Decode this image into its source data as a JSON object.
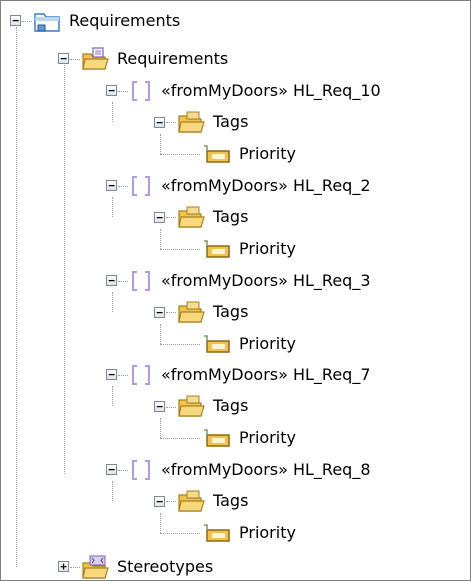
{
  "tree": {
    "root": {
      "label": "Requirements",
      "icon": "package-folder-icon",
      "expanded": true,
      "children": [
        {
          "label": "Requirements",
          "icon": "requirements-folder-icon",
          "expanded": true,
          "children": [
            {
              "label": "«fromMyDoors» HL_Req_10",
              "icon": "requirement-icon",
              "expanded": true,
              "tags": {
                "label": "Tags",
                "icon": "tags-folder-icon",
                "items": [
                  {
                    "label": "Priority",
                    "icon": "tag-icon"
                  }
                ]
              }
            },
            {
              "label": "«fromMyDoors» HL_Req_2",
              "icon": "requirement-icon",
              "expanded": true,
              "tags": {
                "label": "Tags",
                "icon": "tags-folder-icon",
                "items": [
                  {
                    "label": "Priority",
                    "icon": "tag-icon"
                  }
                ]
              }
            },
            {
              "label": "«fromMyDoors» HL_Req_3",
              "icon": "requirement-icon",
              "expanded": true,
              "tags": {
                "label": "Tags",
                "icon": "tags-folder-icon",
                "items": [
                  {
                    "label": "Priority",
                    "icon": "tag-icon"
                  }
                ]
              }
            },
            {
              "label": "«fromMyDoors» HL_Req_7",
              "icon": "requirement-icon",
              "expanded": true,
              "tags": {
                "label": "Tags",
                "icon": "tags-folder-icon",
                "items": [
                  {
                    "label": "Priority",
                    "icon": "tag-icon"
                  }
                ]
              }
            },
            {
              "label": "«fromMyDoors» HL_Req_8",
              "icon": "requirement-icon",
              "expanded": true,
              "tags": {
                "label": "Tags",
                "icon": "tags-folder-icon",
                "items": [
                  {
                    "label": "Priority",
                    "icon": "tag-icon"
                  }
                ]
              }
            }
          ]
        },
        {
          "label": "Stereotypes",
          "icon": "stereotypes-folder-icon",
          "expanded": false,
          "toggle_symbol": "+"
        }
      ]
    },
    "collapse_symbol": "−"
  },
  "colors": {
    "folder_yellow": "#f2c24f",
    "folder_blue": "#5f9ad6",
    "requirement_bracket": "#b79ad9",
    "tree_line": "#9a9a9a"
  }
}
